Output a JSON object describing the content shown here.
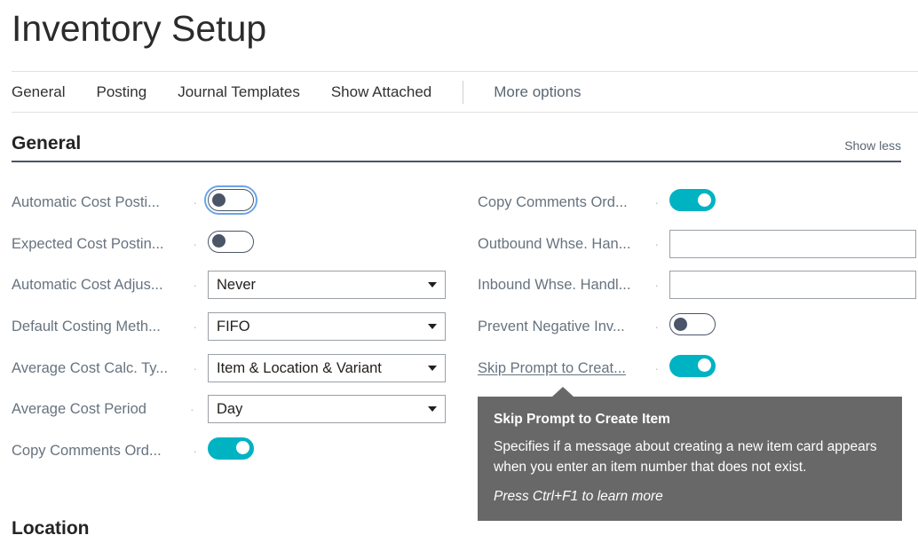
{
  "page": {
    "title": "Inventory Setup"
  },
  "tabbar": {
    "tabs": [
      {
        "label": "General"
      },
      {
        "label": "Posting"
      },
      {
        "label": "Journal Templates"
      },
      {
        "label": "Show Attached"
      }
    ],
    "more_options": "More options"
  },
  "groups": {
    "general": {
      "title": "General",
      "show_less": "Show less"
    },
    "location": {
      "title": "Location"
    }
  },
  "left_column": [
    {
      "label": "Automatic Cost Posti...",
      "dots": "·",
      "control": "toggle",
      "value": "off",
      "focused": true,
      "name": "automatic-cost-posting"
    },
    {
      "label": "Expected Cost Postin...",
      "dots": "·",
      "control": "toggle",
      "value": "off",
      "focused": false,
      "name": "expected-cost-posting"
    },
    {
      "label": "Automatic Cost Adjus...",
      "dots": "·",
      "control": "select",
      "value": "Never",
      "name": "automatic-cost-adjustment"
    },
    {
      "label": "Default Costing Meth...",
      "dots": "·",
      "control": "select",
      "value": "FIFO",
      "name": "default-costing-method"
    },
    {
      "label": "Average Cost Calc. Ty...",
      "dots": "·",
      "control": "select",
      "value": "Item & Location & Variant",
      "name": "average-cost-calc-type"
    },
    {
      "label": "Average Cost Period",
      "dots": "· · ·",
      "control": "select",
      "value": "Day",
      "name": "average-cost-period"
    },
    {
      "label": "Copy Comments Ord...",
      "dots": "·",
      "control": "toggle",
      "value": "on",
      "focused": false,
      "name": "copy-comments-order-to-shipment"
    }
  ],
  "right_column": [
    {
      "label": "Copy Comments Ord...",
      "dots": "·",
      "control": "toggle",
      "value": "on",
      "focused": false,
      "name": "copy-comments-order-to-receipt"
    },
    {
      "label": "Outbound Whse. Han...",
      "dots": "·",
      "control": "textbox",
      "value": "",
      "placeholder": "",
      "name": "outbound-whse-handling-time"
    },
    {
      "label": "Inbound Whse. Handl...",
      "dots": "·",
      "control": "textbox",
      "value": "",
      "placeholder": "",
      "name": "inbound-whse-handling-time"
    },
    {
      "label": "Prevent Negative Inv...",
      "dots": "·",
      "control": "toggle",
      "value": "off",
      "focused": false,
      "name": "prevent-negative-inventory"
    },
    {
      "label": "Skip Prompt to Creat...",
      "dots": "·",
      "control": "toggle",
      "value": "on",
      "focused": false,
      "hovered": true,
      "name": "skip-prompt-to-create-item"
    }
  ],
  "tooltip": {
    "title": "Skip Prompt to Create Item",
    "body": "Specifies if a message about creating a new item card appears when you enter an item number that does not exist.",
    "footer": "Press Ctrl+F1 to learn more"
  },
  "colors": {
    "accent_teal": "#00b3c2",
    "toggle_off": "#4a5568",
    "label": "#67737f",
    "group_underline": "#4a5568",
    "tooltip_bg": "#686868",
    "focus_ring": "#6ba5e7"
  }
}
